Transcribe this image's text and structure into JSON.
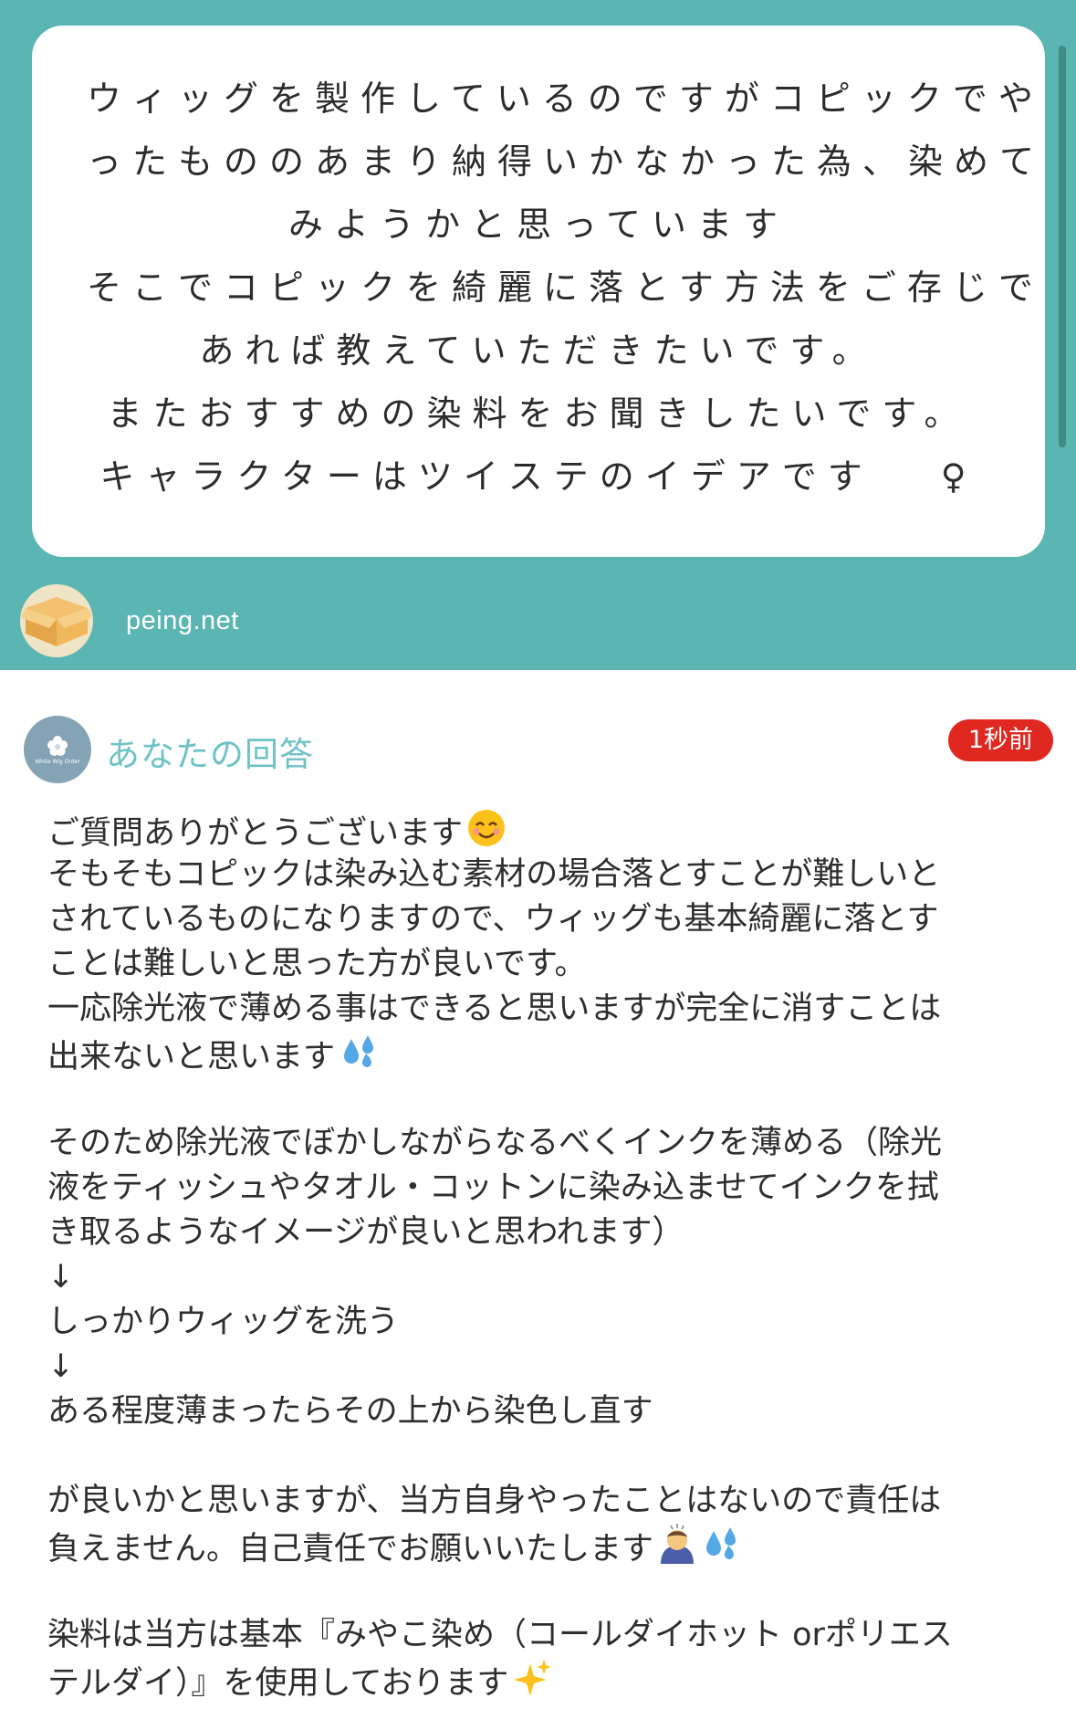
{
  "question": {
    "lines": [
      "ウィッグを製作しているのですがコピックでや",
      "ったもののあまり納得いかなかった為、染めて",
      "みようかと思っています",
      "そこでコピックを綺麗に落とす方法をご存じで",
      "あれば教えていただきたいです。",
      "またおすすめの染料をお聞きしたいです。",
      "キャラクターはツイステのイデアです　 ♀"
    ],
    "source": "peing.net",
    "source_icon": "cardboard-box-icon"
  },
  "answer": {
    "title": "あなたの回答",
    "time": "1秒前",
    "avatar_caption": "White Wig Order",
    "lines": [
      {
        "text": "ご質問ありがとうございます",
        "emoji": "smiling-face"
      },
      {
        "text": "そもそもコピックは染み込む素材の場合落とすことが難しいと"
      },
      {
        "text": "されているものになりますので、ウィッグも基本綺麗に落とす"
      },
      {
        "text": "ことは難しいと思った方が良いです。"
      },
      {
        "text": "一応除光液で薄める事はできると思いますが完全に消すことは"
      },
      {
        "text": "出来ないと思います",
        "emoji": "sweat-droplets"
      },
      {
        "text": ""
      },
      {
        "text": "そのため除光液でぼかしながらなるべくインクを薄める（除光"
      },
      {
        "text": "液をティッシュやタオル・コットンに染み込ませてインクを拭"
      },
      {
        "text": "き取るようなイメージが良いと思われます）"
      },
      {
        "text": "↓"
      },
      {
        "text": "しっかりウィッグを洗う"
      },
      {
        "text": "↓"
      },
      {
        "text": "ある程度薄まったらその上から染色し直す"
      },
      {
        "text": ""
      },
      {
        "text": "が良いかと思いますが、当方自身やったことはないので責任は"
      },
      {
        "text": "負えません。自己責任でお願いいたします",
        "emoji": "bowing-person+sweat-droplets"
      },
      {
        "text": ""
      },
      {
        "text": "染料は当方は基本『みやこ染め（コールダイホット orポリエス"
      },
      {
        "text": "テルダイ）』を使用しております",
        "emoji": "sparkles"
      }
    ]
  },
  "colors": {
    "header_bg": "#5bb6b3",
    "answer_title": "#6fc2c6",
    "badge": "#e02720"
  }
}
